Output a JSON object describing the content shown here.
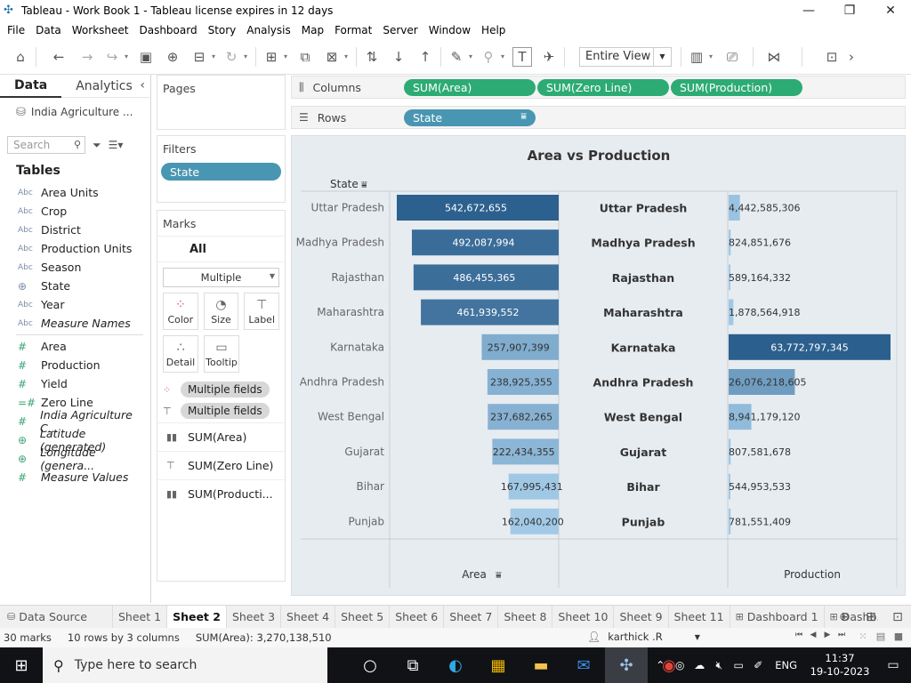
{
  "window": {
    "title": "Tableau - Work Book 1 - Tableau license expires in 12 days",
    "app_icon": "tableau-logo-icon"
  },
  "menu": [
    "File",
    "Data",
    "Worksheet",
    "Dashboard",
    "Story",
    "Analysis",
    "Map",
    "Format",
    "Server",
    "Window",
    "Help"
  ],
  "toolbar": {
    "view_select": "Entire View"
  },
  "data_pane": {
    "tabs": [
      "Data",
      "Analytics"
    ],
    "datasource": "India Agriculture ...",
    "search_placeholder": "Search",
    "tables_header": "Tables",
    "dimensions": [
      {
        "type": "Abc",
        "name": "Area Units"
      },
      {
        "type": "Abc",
        "name": "Crop"
      },
      {
        "type": "Abc",
        "name": "District"
      },
      {
        "type": "Abc",
        "name": "Production Units"
      },
      {
        "type": "Abc",
        "name": "Season"
      },
      {
        "type": "geo",
        "name": "State"
      },
      {
        "type": "Abc",
        "name": "Year"
      },
      {
        "type": "Abc",
        "name": "Measure Names",
        "italic": true
      }
    ],
    "measures": [
      {
        "type": "#",
        "name": "Area"
      },
      {
        "type": "#",
        "name": "Production"
      },
      {
        "type": "#",
        "name": "Yield"
      },
      {
        "type": "=#",
        "name": "Zero Line"
      },
      {
        "type": "#",
        "name": "India Agriculture C...",
        "italic": true
      },
      {
        "type": "geo",
        "name": "Latitude (generated)",
        "italic": true
      },
      {
        "type": "geo",
        "name": "Longitude (genera...",
        "italic": true
      },
      {
        "type": "#",
        "name": "Measure Values",
        "italic": true
      }
    ]
  },
  "cards": {
    "pages_label": "Pages",
    "filters_label": "Filters",
    "filter_pill": "State",
    "marks_label": "Marks",
    "marks_all": "All",
    "mark_type": "Multiple",
    "mark_buttons": [
      "Color",
      "Size",
      "Label",
      "Detail",
      "Tooltip"
    ],
    "mark_fields": [
      "Multiple fields",
      "Multiple fields"
    ],
    "mark_rows": [
      "SUM(Area)",
      "SUM(Zero Line)",
      "SUM(Producti..."
    ]
  },
  "shelves": {
    "columns_label": "Columns",
    "rows_label": "Rows",
    "column_pills": [
      "SUM(Area)",
      "SUM(Zero Line)",
      "SUM(Production)"
    ],
    "row_pills": [
      "State"
    ]
  },
  "chart_data": {
    "type": "bar",
    "title": "Area vs Production",
    "row_header": "State",
    "categories": [
      "Uttar Pradesh",
      "Madhya Pradesh",
      "Rajasthan",
      "Maharashtra",
      "Karnataka",
      "Andhra Pradesh",
      "West Bengal",
      "Gujarat",
      "Bihar",
      "Punjab"
    ],
    "series": [
      {
        "name": "Area",
        "values": [
          542672655,
          492087994,
          486455365,
          461939552,
          257907399,
          238925355,
          237682265,
          222434355,
          167995431,
          162040200
        ],
        "labels": [
          "542,672,655",
          "492,087,994",
          "486,455,365",
          "461,939,552",
          "257,907,399",
          "238,925,355",
          "237,682,265",
          "222,434,355",
          "167,995,431",
          "162,040,200"
        ]
      },
      {
        "name": "Production",
        "values": [
          4442585306,
          824851676,
          589164332,
          1878564918,
          63772797345,
          26076218605,
          8941179120,
          807581678,
          544953533,
          781551409
        ],
        "labels": [
          "4,442,585,306",
          "824,851,676",
          "589,164,332",
          "1,878,564,918",
          "63,772,797,345",
          "26,076,218,605",
          "8,941,179,120",
          "807,581,678",
          "544,953,533",
          "781,551,409"
        ]
      }
    ],
    "axis_labels": [
      "Area",
      "Production"
    ],
    "colors": {
      "dark": "#2b5f8e",
      "light": "#a3cbe8",
      "bg": "#e7ecf1"
    }
  },
  "sheet_tabs": {
    "datasource": "Data Source",
    "sheets": [
      "Sheet 1",
      "Sheet 2",
      "Sheet 3",
      "Sheet 4",
      "Sheet 5",
      "Sheet 6",
      "Sheet 7",
      "Sheet 8",
      "Sheet 10",
      "Sheet 9",
      "Sheet 11"
    ],
    "active": "Sheet 2",
    "dashboards": [
      "Dashboard 1",
      "Dashb..."
    ]
  },
  "status": {
    "marks": "30 marks",
    "rows_cols": "10 rows by 3 columns",
    "sum": "SUM(Area): 3,270,138,510",
    "user": "karthick .R"
  },
  "taskbar": {
    "search_placeholder": "Type here to search",
    "language": "ENG",
    "time": "11:37",
    "date": "19-10-2023"
  }
}
